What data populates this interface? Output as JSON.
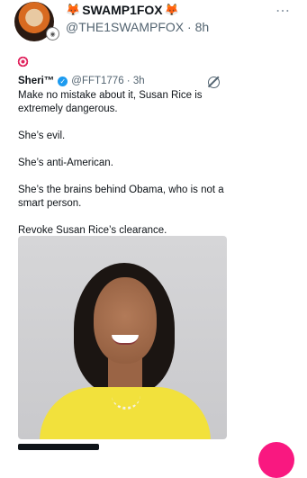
{
  "tweet": {
    "display_name": "SWAMP1FOX",
    "name_emoji": "🦊",
    "handle_time": "@THE1SWAMPFOX · 8h",
    "more_icon": "⋯",
    "reply_emoji": "🎯"
  },
  "quoted": {
    "name": "Sheri™",
    "verified_icon": "✓",
    "handle_time": "@FFT1776 · 3h",
    "paragraphs": [
      "Make no mistake about it, Susan Rice is extremely dangerous.",
      "She’s evil.",
      "She’s anti-American.",
      "She’s the brains behind Obama, who is not a smart person.",
      "Revoke Susan Rice’s clearance."
    ]
  },
  "colors": {
    "accent_blue": "#1d9bf0",
    "text_secondary": "#536471",
    "fab_pink": "#f91880"
  }
}
